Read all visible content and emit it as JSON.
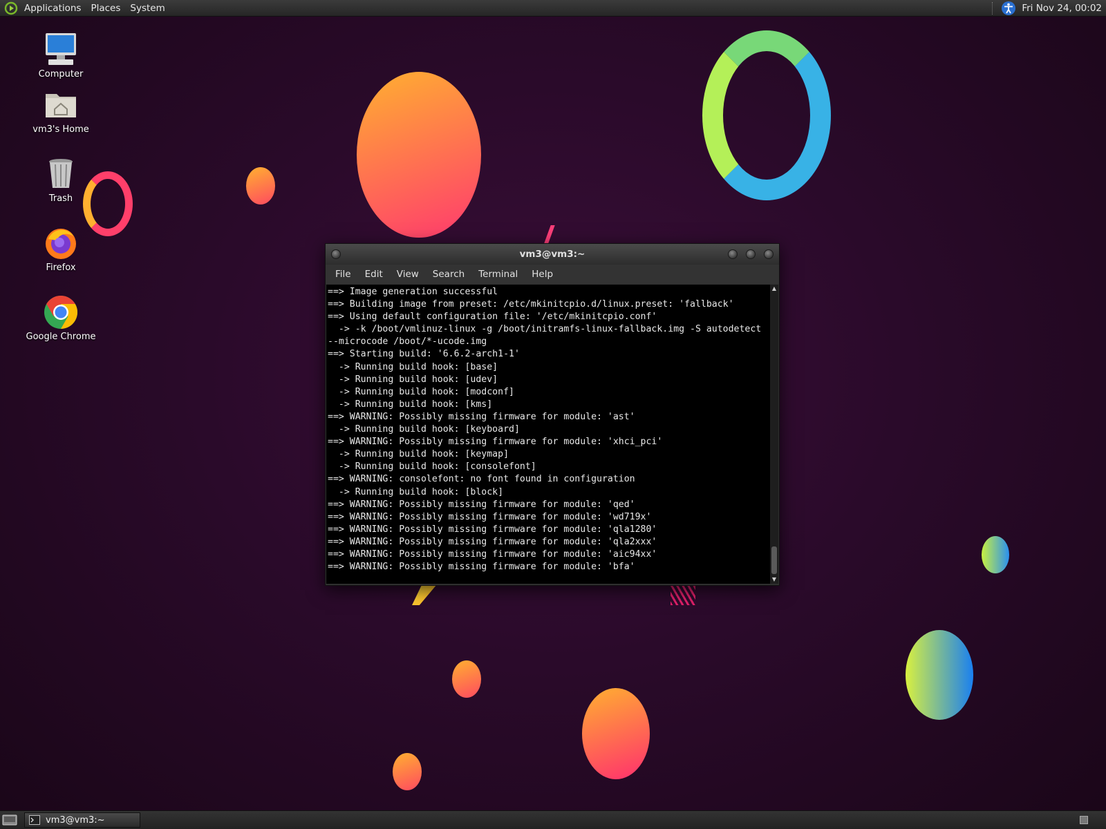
{
  "top_panel": {
    "menus": [
      "Applications",
      "Places",
      "System"
    ],
    "clock": "Fri Nov 24, 00:02"
  },
  "desktop": {
    "icons": [
      {
        "label": "Computer",
        "icon": "computer-icon"
      },
      {
        "label": "vm3's Home",
        "icon": "home-folder-icon"
      },
      {
        "label": "Trash",
        "icon": "trash-icon"
      },
      {
        "label": "Firefox",
        "icon": "firefox-icon"
      },
      {
        "label": "Google Chrome",
        "icon": "chrome-icon"
      }
    ]
  },
  "terminal": {
    "title": "vm3@vm3:~",
    "menus": [
      "File",
      "Edit",
      "View",
      "Search",
      "Terminal",
      "Help"
    ],
    "lines": [
      "==> Image generation successful",
      "==> Building image from preset: /etc/mkinitcpio.d/linux.preset: 'fallback'",
      "==> Using default configuration file: '/etc/mkinitcpio.conf'",
      "  -> -k /boot/vmlinuz-linux -g /boot/initramfs-linux-fallback.img -S autodetect",
      "--microcode /boot/*-ucode.img",
      "==> Starting build: '6.6.2-arch1-1'",
      "  -> Running build hook: [base]",
      "  -> Running build hook: [udev]",
      "  -> Running build hook: [modconf]",
      "  -> Running build hook: [kms]",
      "==> WARNING: Possibly missing firmware for module: 'ast'",
      "  -> Running build hook: [keyboard]",
      "==> WARNING: Possibly missing firmware for module: 'xhci_pci'",
      "  -> Running build hook: [keymap]",
      "  -> Running build hook: [consolefont]",
      "==> WARNING: consolefont: no font found in configuration",
      "  -> Running build hook: [block]",
      "==> WARNING: Possibly missing firmware for module: 'qed'",
      "==> WARNING: Possibly missing firmware for module: 'wd719x'",
      "==> WARNING: Possibly missing firmware for module: 'qla1280'",
      "==> WARNING: Possibly missing firmware for module: 'qla2xxx'",
      "==> WARNING: Possibly missing firmware for module: 'aic94xx'",
      "==> WARNING: Possibly missing firmware for module: 'bfa'"
    ]
  },
  "taskbar": {
    "items": [
      {
        "label": "vm3@vm3:~",
        "icon": "terminal-icon"
      }
    ]
  }
}
